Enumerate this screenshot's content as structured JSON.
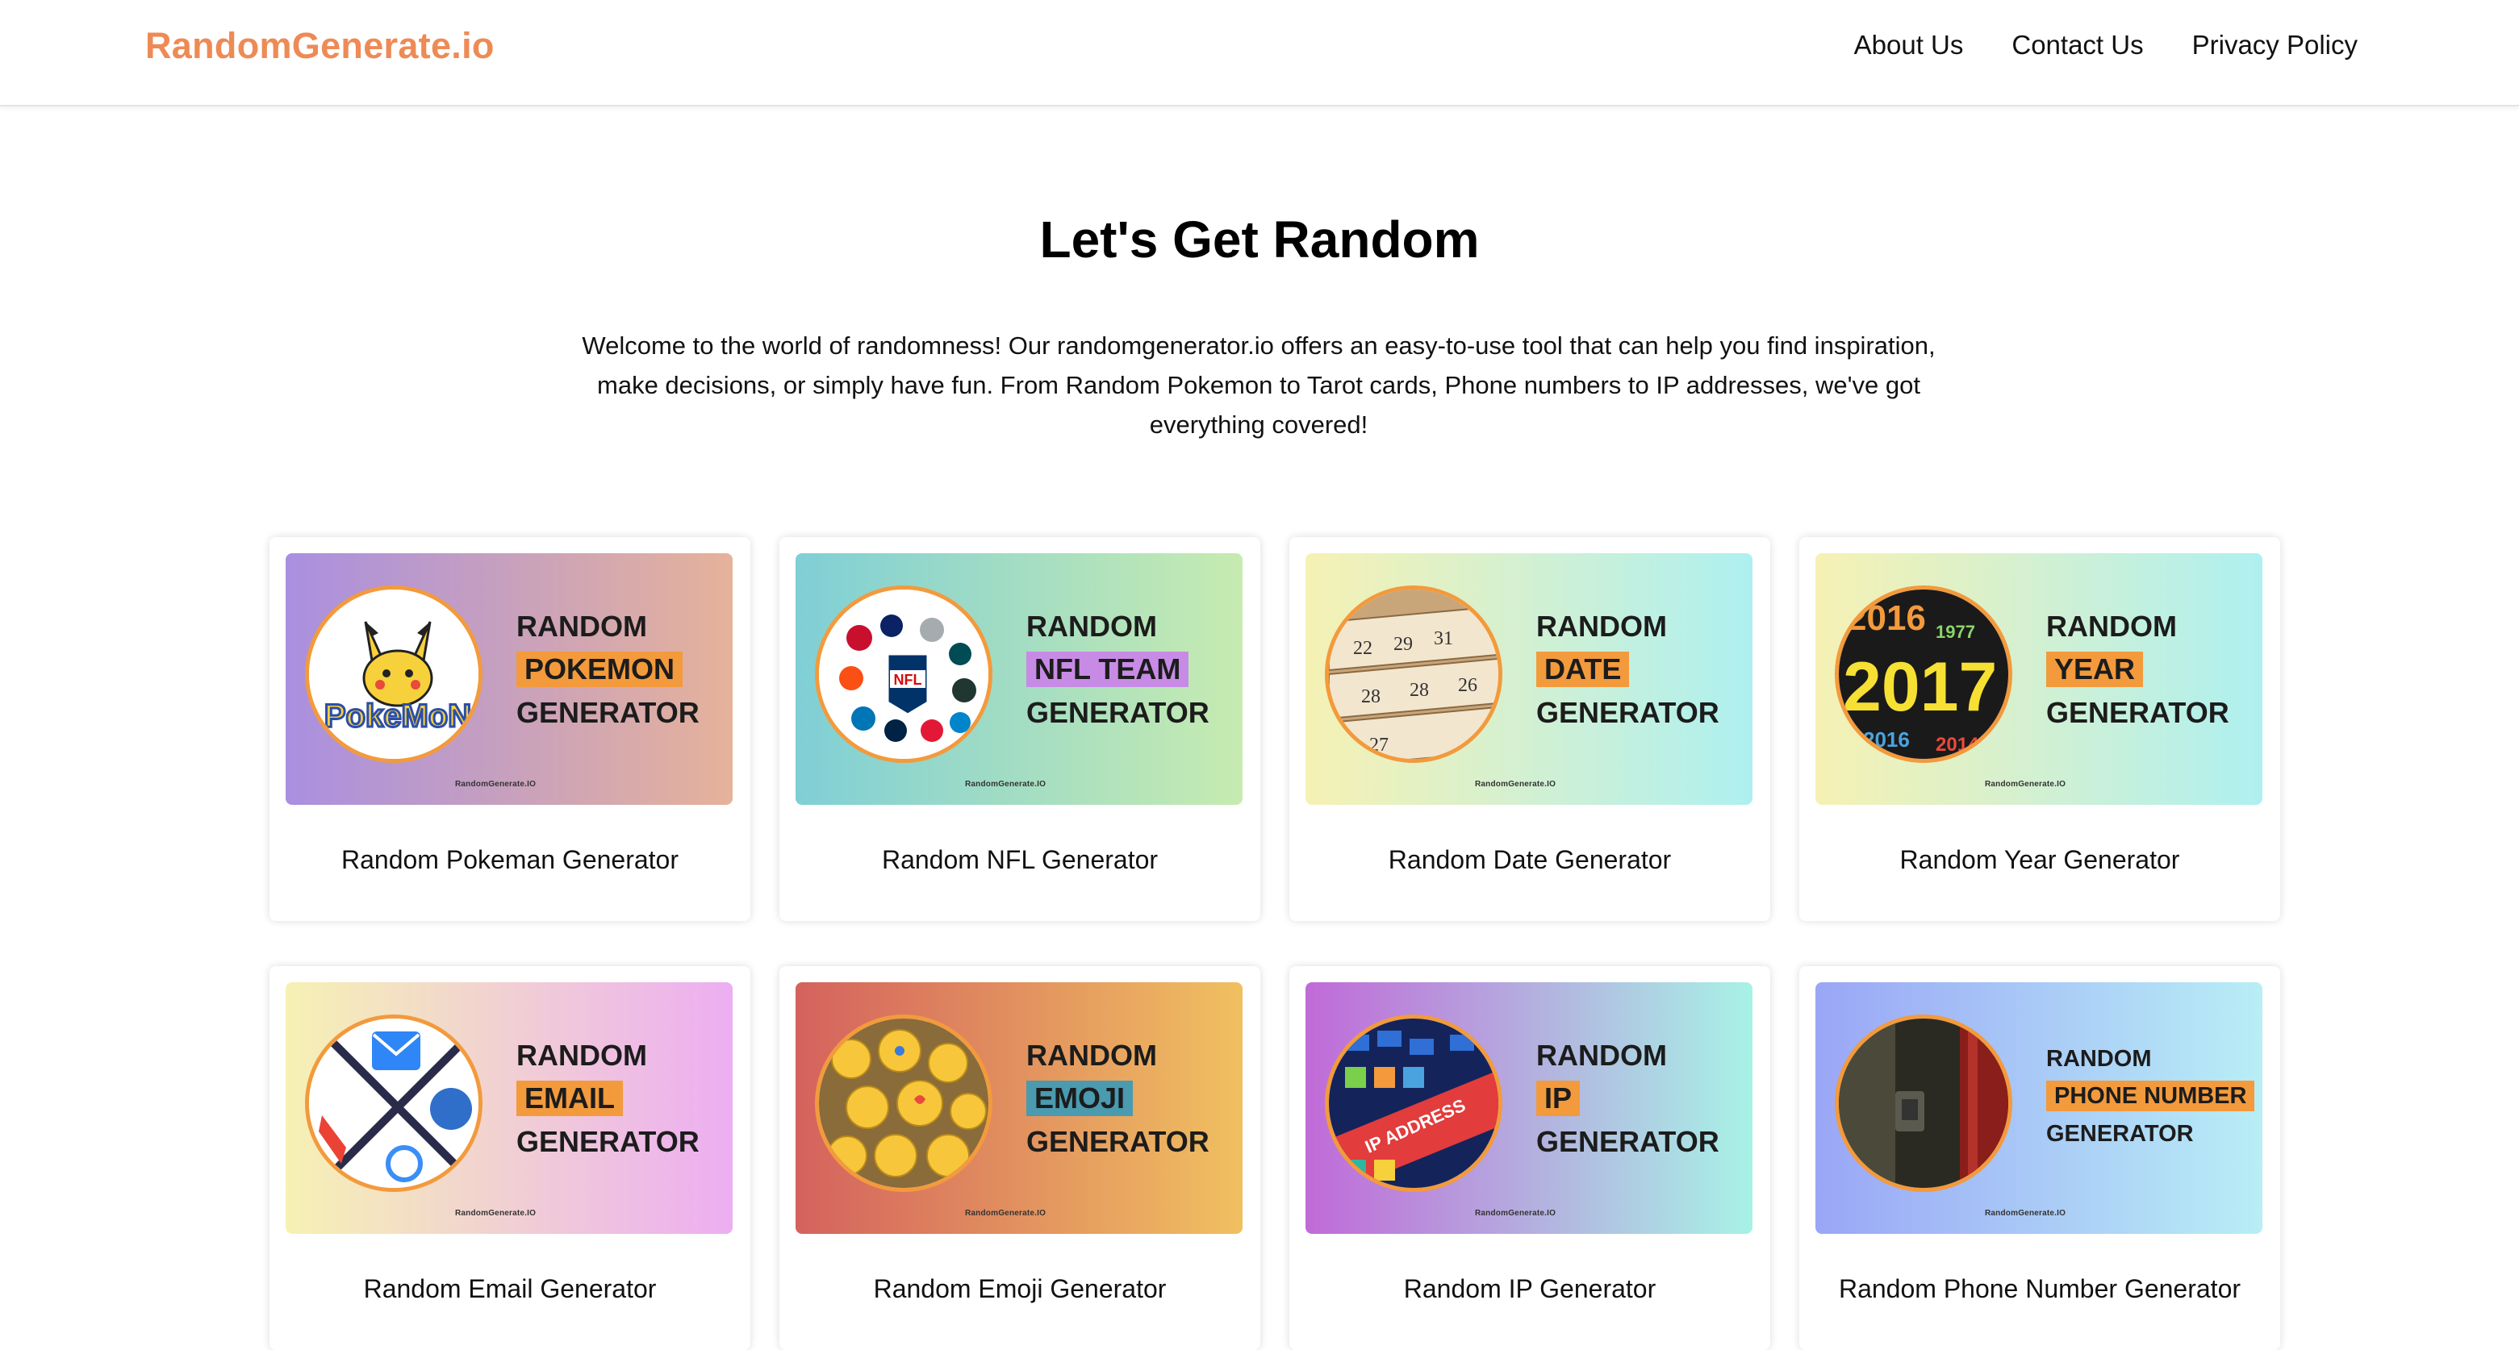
{
  "header": {
    "brand": "RandomGenerate.io",
    "nav": [
      "About Us",
      "Contact Us",
      "Privacy Policy"
    ]
  },
  "hero": {
    "title": "Let's Get Random",
    "text_lines": [
      "Welcome to the world of randomness! Our randomgenerator.io offers an easy-to-use tool that can help you find inspiration,",
      "make decisions, or simply have fun. From Random Pokemon to Tarot cards, Phone numbers to IP addresses, we've got",
      "everything covered!"
    ]
  },
  "cards": [
    {
      "title": "Random Pokeman Generator",
      "banner": [
        "RANDOM",
        "POKEMON",
        "GENERATOR"
      ],
      "tag": "RandomGenerate.IO",
      "icon": "pikachu-icon",
      "circle_text": "PokeMoN",
      "gradient": [
        "#a98fe0",
        "#e6b29a"
      ],
      "highlight": "#f39a3c"
    },
    {
      "title": "Random NFL Generator",
      "banner": [
        "RANDOM",
        "NFL TEAM",
        "GENERATOR"
      ],
      "tag": "RandomGenerate.IO",
      "icon": "nfl-logos-icon",
      "circle_text": "NFL",
      "gradient": [
        "#7fcfd6",
        "#c7ebb0"
      ],
      "highlight": "#c78be6"
    },
    {
      "title": "Random Date Generator",
      "banner": [
        "RANDOM",
        "DATE",
        "GENERATOR"
      ],
      "tag": "RandomGenerate.IO",
      "icon": "calendar-icon",
      "circle_text": "29",
      "gradient": [
        "#f6f1b4",
        "#aef0f0"
      ],
      "highlight": "#f39a3c"
    },
    {
      "title": "Random Year Generator",
      "banner": [
        "RANDOM",
        "YEAR",
        "GENERATOR"
      ],
      "tag": "RandomGenerate.IO",
      "icon": "year-numbers-icon",
      "circle_text": "2017",
      "gradient": [
        "#f6f1b4",
        "#aef0f0"
      ],
      "highlight": "#f39a3c"
    },
    {
      "title": "Random Email Generator",
      "banner": [
        "RANDOM",
        "EMAIL",
        "GENERATOR"
      ],
      "tag": "RandomGenerate.IO",
      "icon": "email-apps-icon",
      "circle_text": "",
      "gradient": [
        "#f6f1b4",
        "#ecaef2"
      ],
      "highlight": "#f39a3c"
    },
    {
      "title": "Random Emoji Generator",
      "banner": [
        "RANDOM",
        "EMOJI",
        "GENERATOR"
      ],
      "tag": "RandomGenerate.IO",
      "icon": "emoji-pile-icon",
      "circle_text": "",
      "gradient": [
        "#d4625e",
        "#f0c060"
      ],
      "highlight": "#4a9ab0"
    },
    {
      "title": "Random IP Generator",
      "banner": [
        "RANDOM",
        "IP",
        "GENERATOR"
      ],
      "tag": "RandomGenerate.IO",
      "icon": "ip-address-icon",
      "circle_text": "IP ADDRESS",
      "gradient": [
        "#c06ad8",
        "#a8f2e6"
      ],
      "highlight": "#f39a3c"
    },
    {
      "title": "Random Phone Number Generator",
      "banner": [
        "RANDOM",
        "PHONE NUMBER",
        "GENERATOR"
      ],
      "tag": "RandomGenerate.IO",
      "icon": "phone-booth-icon",
      "circle_text": "",
      "gradient": [
        "#9aa6f6",
        "#b8eef6"
      ],
      "highlight": "#f39a3c"
    }
  ]
}
